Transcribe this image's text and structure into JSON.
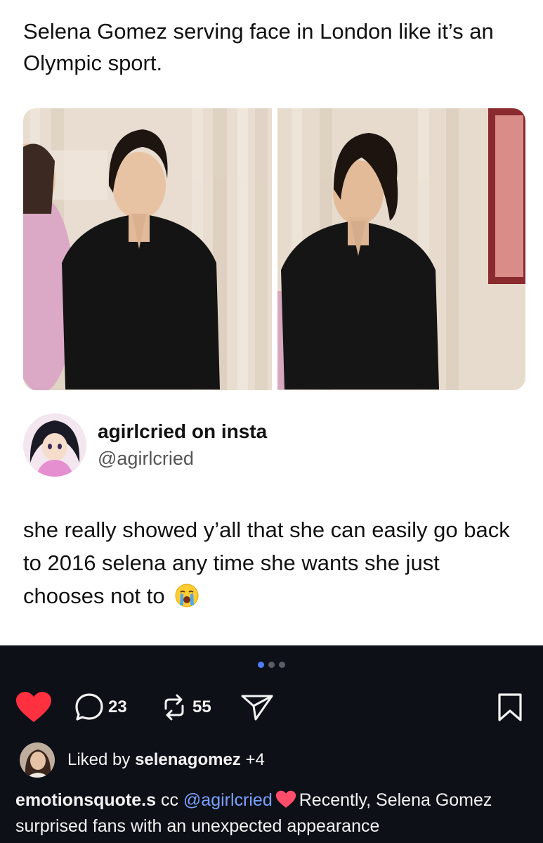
{
  "tweet": {
    "quote_text": "Selena Gomez serving face in London like it’s an Olympic sport.",
    "author_name": "agirlcried on insta",
    "author_handle": "@agirlcried",
    "body_text": "she really showed y’all that she can easily go back to 2016 selena any time she wants she just chooses not to",
    "body_emoji": "loudly-crying-face-icon"
  },
  "carousel": {
    "total_dots": 3,
    "active_index": 0
  },
  "actions": {
    "like_icon": "heart-icon",
    "comment_icon": "comment-icon",
    "comment_count": "23",
    "repost_icon": "repost-icon",
    "repost_count": "55",
    "share_icon": "send-icon",
    "save_icon": "bookmark-icon"
  },
  "liked_by": {
    "prefix": "Liked by ",
    "user": "selenagomez",
    "suffix": " +4"
  },
  "caption": {
    "username": "emotionsquote.s",
    "pre_mention": " cc ",
    "mention": "@agirlcried",
    "heart_icon": "heart-icon",
    "text": "Recently, Selena Gomez surprised fans with an unexpected appearance"
  },
  "colors": {
    "dark_bg": "#0d1017",
    "like_red": "#ff3040",
    "mention_blue": "#7aa0ff",
    "dot_active": "#4f7cff"
  }
}
